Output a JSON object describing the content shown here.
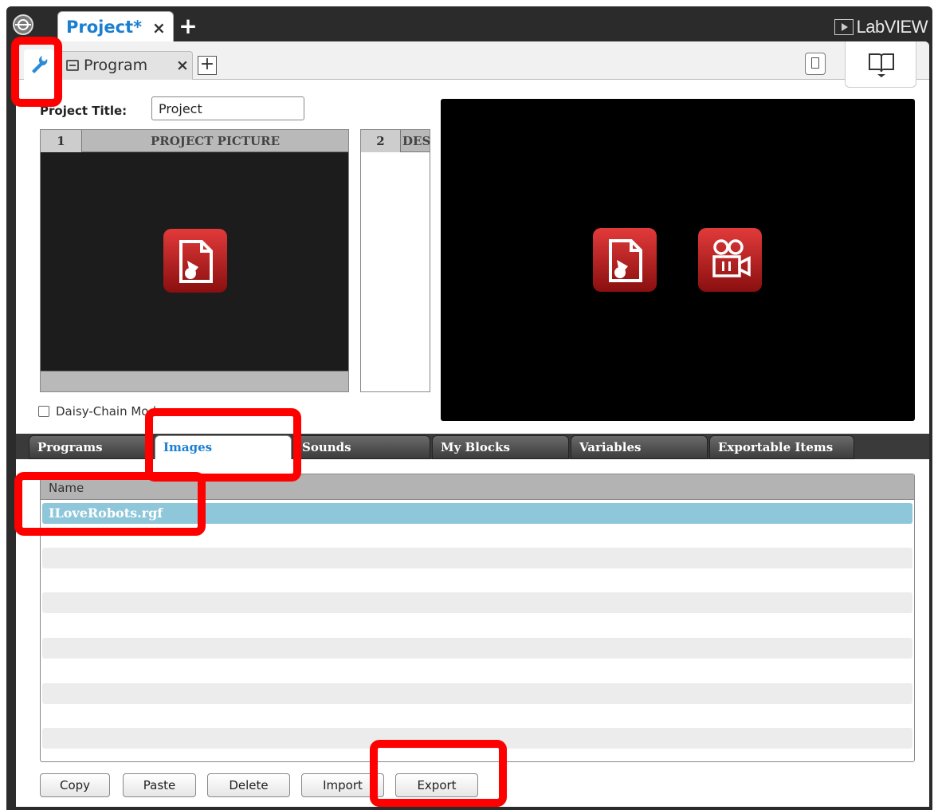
{
  "window": {
    "project_tab": "Project*",
    "project_tab_close": "×",
    "add_tab": "+",
    "brand": "LabVIEW"
  },
  "subtabs": {
    "program_tab": "Program",
    "program_tab_close": "×",
    "add_program": "+"
  },
  "project": {
    "title_label": "Project Title:",
    "title_value": "Project",
    "picture_num": "1",
    "picture_title": "PROJECT PICTURE",
    "desc_num": "2",
    "desc_title": "DESCRIPTION",
    "daisy_chain_label": "Daisy-Chain Mode",
    "daisy_chain_checked": false
  },
  "content_tabs": [
    "Programs",
    "Images",
    "Sounds",
    "My Blocks",
    "Variables",
    "Exportable Items"
  ],
  "active_tab": "Images",
  "list": {
    "column_name": "Name",
    "items": [
      "ILoveRobots.rgf"
    ],
    "selected": "ILoveRobots.rgf"
  },
  "actions": {
    "copy": "Copy",
    "paste": "Paste",
    "delete": "Delete",
    "import": "Import",
    "export": "Export"
  },
  "colors": {
    "accent": "#1a7fd0",
    "selected_row": "#8ec6da",
    "highlight": "#ff0000"
  },
  "icons": [
    "home-icon",
    "wrench-icon",
    "program-icon",
    "page-icon",
    "book-icon",
    "image-file-icon",
    "video-file-icon"
  ]
}
